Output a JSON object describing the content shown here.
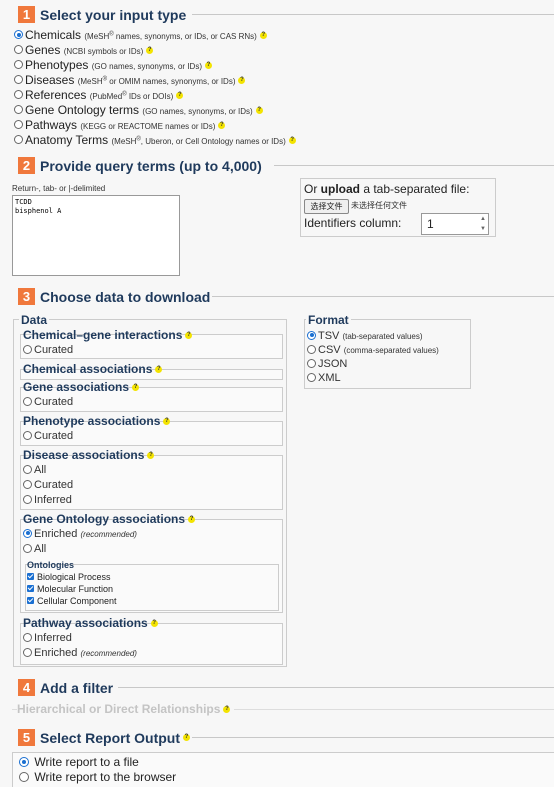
{
  "step1": {
    "num": "1",
    "title": "Select your input type",
    "options": [
      {
        "label": "Chemicals",
        "hint_a": "(MeSH",
        "hint_sup": "®",
        "hint_b": " names, synonyms, or IDs, or CAS RNs)",
        "selected": true
      },
      {
        "label": "Genes",
        "hint_a": "(NCBI symbols or IDs)",
        "hint_sup": "",
        "hint_b": "",
        "selected": false
      },
      {
        "label": "Phenotypes",
        "hint_a": "(GO names, synonyms, or IDs)",
        "hint_sup": "",
        "hint_b": "",
        "selected": false
      },
      {
        "label": "Diseases",
        "hint_a": "(MeSH",
        "hint_sup": "®",
        "hint_b": " or OMIM names, synonyms, or IDs)",
        "selected": false
      },
      {
        "label": "References",
        "hint_a": "(PubMed",
        "hint_sup": "®",
        "hint_b": " IDs or DOIs)",
        "selected": false
      },
      {
        "label": "Gene Ontology terms",
        "hint_a": "(GO names, synonyms, or IDs)",
        "hint_sup": "",
        "hint_b": "",
        "selected": false
      },
      {
        "label": "Pathways",
        "hint_a": "(KEGG or REACTOME names or IDs)",
        "hint_sup": "",
        "hint_b": "",
        "selected": false
      },
      {
        "label": "Anatomy Terms",
        "hint_a": "(MeSH",
        "hint_sup": "®",
        "hint_b": ", Uberon, or Cell Ontology names or IDs)",
        "selected": false
      }
    ]
  },
  "step2": {
    "num": "2",
    "title": "Provide query terms (up to 4,000)",
    "delim_label": "Return-, tab- or |-delimited",
    "textarea_value": "TCDD\nbisphenol A",
    "upload_or": "Or ",
    "upload_word": "upload",
    "upload_rest": " a tab-separated file:",
    "choose_btn": "选择文件",
    "no_file": "未选择任何文件",
    "id_col_label": "Identifiers column:",
    "id_col_value": "1"
  },
  "step3": {
    "num": "3",
    "title": "Choose data to download",
    "data_legend": "Data",
    "chem_gene": {
      "title": "Chemical–gene interactions",
      "opts": [
        "Curated"
      ]
    },
    "chem_assoc": {
      "title": "Chemical associations"
    },
    "gene_assoc": {
      "title": "Gene associations",
      "opts": [
        "Curated"
      ]
    },
    "pheno_assoc": {
      "title": "Phenotype associations",
      "opts": [
        "Curated"
      ]
    },
    "disease_assoc": {
      "title": "Disease associations",
      "opts": [
        "All",
        "Curated",
        "Inferred"
      ]
    },
    "go_assoc": {
      "title": "Gene Ontology associations",
      "enriched": "Enriched",
      "recommended": "(recommended)",
      "all": "All",
      "ontologies_title": "Ontologies",
      "ontologies": [
        "Biological Process",
        "Molecular Function",
        "Cellular Component"
      ]
    },
    "pathway_assoc": {
      "title": "Pathway associations",
      "inferred": "Inferred",
      "enriched": "Enriched",
      "recommended": "(recommended)"
    },
    "format": {
      "legend": "Format",
      "opts": [
        {
          "label": "TSV",
          "hint": "(tab-separated values)",
          "selected": true
        },
        {
          "label": "CSV",
          "hint": "(comma-separated values)",
          "selected": false
        },
        {
          "label": "JSON",
          "hint": "",
          "selected": false
        },
        {
          "label": "XML",
          "hint": "",
          "selected": false
        }
      ]
    }
  },
  "step4": {
    "num": "4",
    "title": "Add a filter",
    "sub": "Hierarchical or Direct Relationships"
  },
  "step5": {
    "num": "5",
    "title": "Select Report Output",
    "opts": [
      {
        "label": "Write report to a file",
        "selected": true
      },
      {
        "label": "Write report to the browser",
        "selected": false
      }
    ]
  },
  "help_glyph": "?",
  "colors": {
    "accent": "#f0783c",
    "heading": "#1f3a5c",
    "help": "#f3e300",
    "radio": "#1a6fd1"
  }
}
